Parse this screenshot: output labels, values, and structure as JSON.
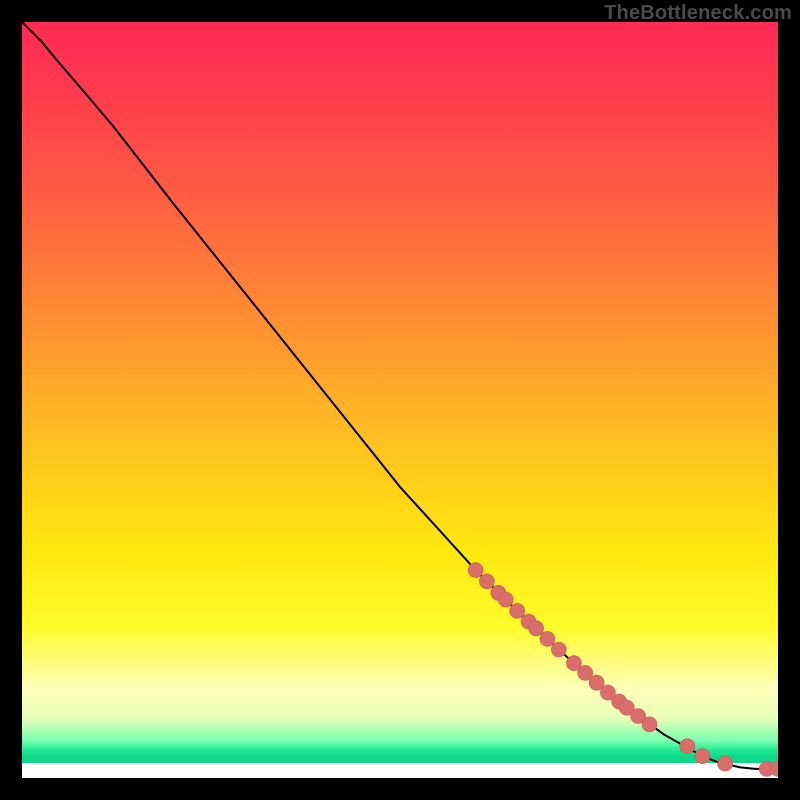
{
  "watermark": "TheBottleneck.com",
  "colors": {
    "marker_fill": "#d86d6a",
    "marker_stroke": "#c95a58",
    "line": "#000000"
  },
  "chart_data": {
    "type": "line",
    "title": "",
    "xlabel": "",
    "ylabel": "",
    "xlim": [
      0,
      100
    ],
    "ylim": [
      0,
      100
    ],
    "grid": false,
    "legend": false,
    "series": [
      {
        "name": "curve",
        "kind": "line",
        "x": [
          0,
          2.5,
          5,
          8,
          12,
          20,
          30,
          40,
          50,
          60,
          65,
          70,
          75,
          80,
          85,
          90,
          92,
          95,
          97,
          100
        ],
        "y": [
          100,
          97.5,
          94.5,
          91,
          86.3,
          76,
          63.5,
          51,
          38.5,
          27.5,
          22.6,
          17.9,
          13.4,
          9.3,
          5.7,
          2.9,
          2.1,
          1.4,
          1.2,
          1.2
        ]
      },
      {
        "name": "markers",
        "kind": "scatter",
        "x": [
          60,
          61.5,
          63,
          64,
          65.5,
          67,
          68,
          69.5,
          71,
          73,
          74.5,
          76,
          77.5,
          79,
          80,
          81.5,
          83,
          88,
          90,
          93,
          98.5,
          100
        ],
        "y": [
          27.5,
          26.0,
          24.5,
          23.6,
          22.1,
          20.7,
          19.8,
          18.4,
          17.0,
          15.2,
          13.9,
          12.6,
          11.3,
          10.1,
          9.3,
          8.2,
          7.1,
          4.2,
          2.9,
          1.9,
          1.2,
          1.2
        ]
      }
    ]
  }
}
